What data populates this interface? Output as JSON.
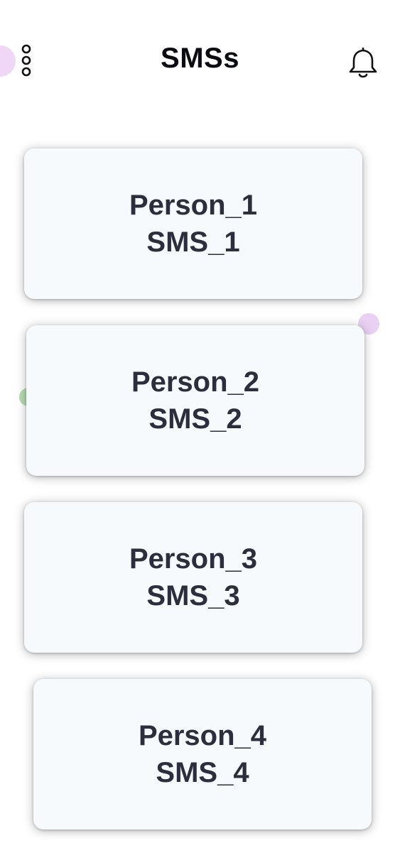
{
  "header": {
    "title": "SMSs",
    "menu_icon": "more-vertical-icon",
    "notification_icon": "bell-icon"
  },
  "messages": [
    {
      "person": "Person_1",
      "sms": "SMS_1"
    },
    {
      "person": "Person_2",
      "sms": "SMS_2"
    },
    {
      "person": "Person_3",
      "sms": "SMS_3"
    },
    {
      "person": "Person_4",
      "sms": "SMS_4"
    }
  ],
  "colors": {
    "card_background": "#f7fafd",
    "card_text": "#2b2e3c",
    "title_text": "#0b0b12",
    "accent_purple": "#e9c8f2",
    "accent_green": "#a7d9a4"
  }
}
